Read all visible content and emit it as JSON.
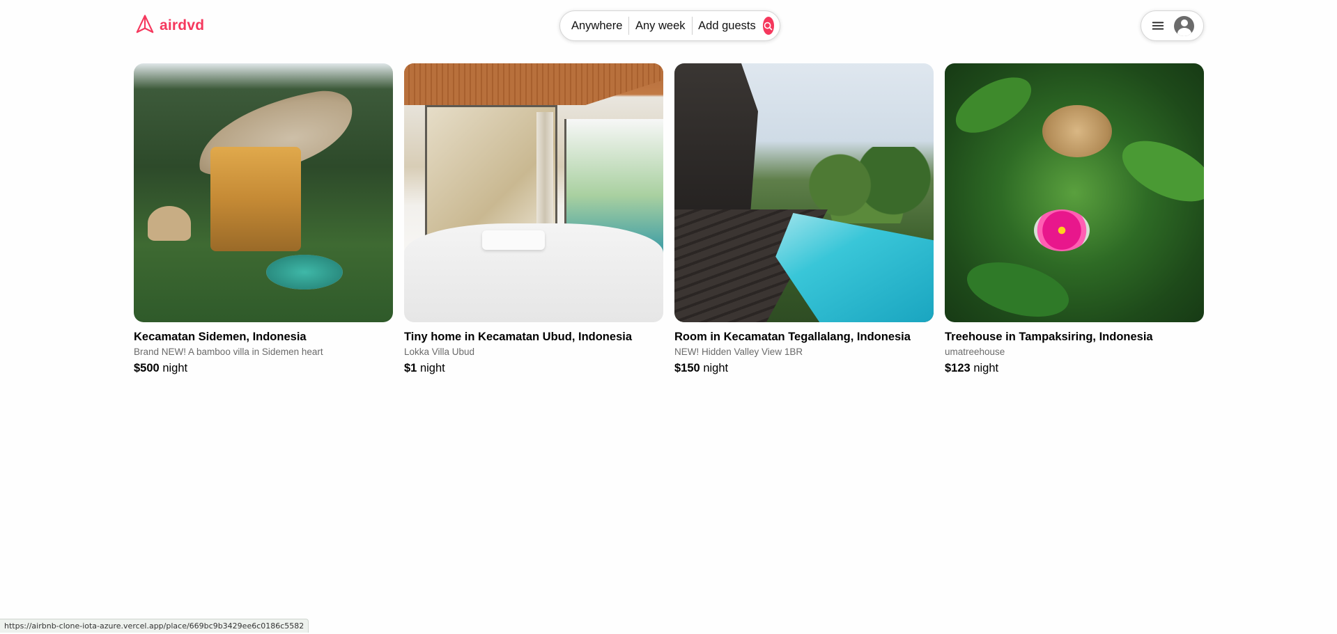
{
  "header": {
    "logo_text": "airdvd",
    "search": {
      "location_label": "Anywhere",
      "dates_label": "Any week",
      "guests_label": "Add guests"
    }
  },
  "listings": [
    {
      "title": "Kecamatan Sidemen, Indonesia",
      "subtitle": "Brand NEW! A bamboo villa in Sidemen heart",
      "price": "$500",
      "price_unit": "night"
    },
    {
      "title": "Tiny home in Kecamatan Ubud, Indonesia",
      "subtitle": "Lokka Villa Ubud",
      "price": "$1",
      "price_unit": "night"
    },
    {
      "title": "Room in Kecamatan Tegallalang, Indonesia",
      "subtitle": "NEW! Hidden Valley View 1BR",
      "price": "$150",
      "price_unit": "night"
    },
    {
      "title": "Treehouse in Tampaksiring, Indonesia",
      "subtitle": "umatreehouse",
      "price": "$123",
      "price_unit": "night"
    }
  ],
  "status_bar": {
    "url": "https://airbnb-clone-iota-azure.vercel.app/place/669bc9b3429ee6c0186c5582"
  },
  "colors": {
    "brand": "#f5385d",
    "text": "#111111",
    "muted": "#6a6a6a"
  },
  "icons": {
    "logo": "paper-plane-icon",
    "search": "search-icon",
    "menu": "hamburger-menu-icon",
    "avatar": "user-avatar-icon"
  }
}
